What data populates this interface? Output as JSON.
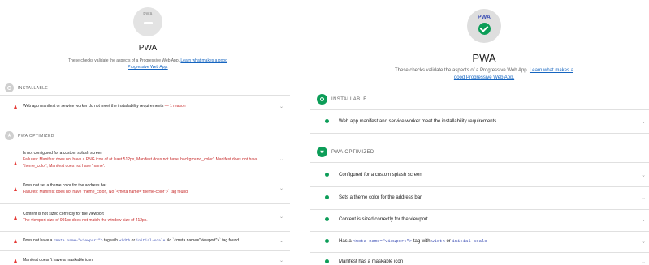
{
  "left": {
    "gauge_label": "PWA",
    "title": "PWA",
    "description": "These checks validate the aspects of a Progressive Web App.",
    "learn_link": "Learn what makes a good Progressive Web App.",
    "installable": {
      "label": "INSTALLABLE",
      "audits": [
        {
          "text": "Web app manifest or service worker do not meet the installability requirements",
          "extra": "— 1 reason"
        }
      ]
    },
    "optimized": {
      "label": "PWA OPTIMIZED",
      "audits": [
        {
          "title": "Is not configured for a custom splash screen",
          "detail": "Failures: Manifest does not have a PNG icon of at least 512px, Manifest does not have 'background_color', Manifest does not have 'theme_color', Manifest does not have 'name'."
        },
        {
          "title": "Does not set a theme color for the address bar.",
          "detail": "Failures: Manifest does not have 'theme_color', No `<meta name=\"theme-color\">` tag found."
        },
        {
          "title": "Content is not sized correctly for the viewport",
          "detail": "The viewport size of 991px does not match the window size of 412px."
        },
        {
          "pre": "Does not have a",
          "code1": "<meta name=\"viewport\">",
          "mid": "tag with",
          "code2": "width",
          "or": "or",
          "code3": "initial-scale",
          "post": "No `<meta name=\"viewport\">` tag found"
        },
        {
          "title": "Manifest doesn't have a maskable icon"
        }
      ]
    }
  },
  "right": {
    "gauge_label": "PWA",
    "title": "PWA",
    "description": "These checks validate the aspects of a Progressive Web App.",
    "learn_link": "Learn what makes a good Progressive Web App.",
    "installable": {
      "label": "INSTALLABLE",
      "audits": [
        {
          "text": "Web app manifest and service worker meet the installability requirements"
        }
      ]
    },
    "optimized": {
      "label": "PWA OPTIMIZED",
      "audits": [
        {
          "text": "Configured for a custom splash screen"
        },
        {
          "text": "Sets a theme color for the address bar."
        },
        {
          "text": "Content is sized correctly for the viewport"
        },
        {
          "pre": "Has a",
          "code1": "<meta name=\"viewport\">",
          "mid": "tag with",
          "code2": "width",
          "or": "or",
          "code3": "initial-scale"
        },
        {
          "text": "Manifest has a maskable icon"
        }
      ]
    }
  },
  "icons": {
    "fail": "warning-triangle-icon",
    "pass": "pass-dot-icon",
    "chevron": "chevron-down-icon"
  },
  "colors": {
    "fail": "#e53935",
    "pass": "#0c9d58",
    "link": "#1565c0"
  }
}
